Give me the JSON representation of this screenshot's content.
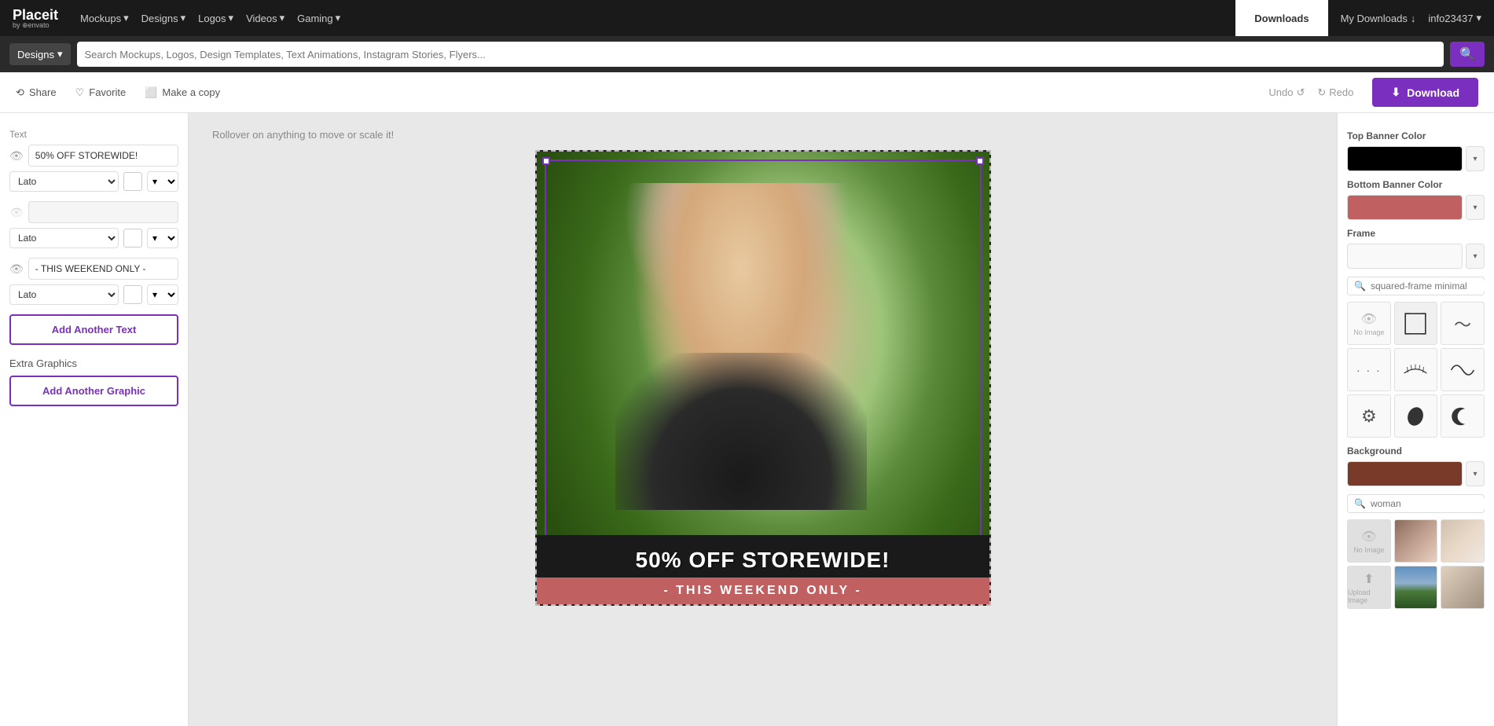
{
  "topnav": {
    "logo": "Placeit",
    "logo_sub": "by ⊕envato",
    "nav_items": [
      {
        "label": "Mockups",
        "id": "mockups"
      },
      {
        "label": "Designs",
        "id": "designs"
      },
      {
        "label": "Logos",
        "id": "logos"
      },
      {
        "label": "Videos",
        "id": "videos"
      },
      {
        "label": "Gaming",
        "id": "gaming"
      }
    ],
    "downloads_label": "Downloads",
    "my_downloads_label": "My Downloads",
    "account_label": "info23437"
  },
  "searchbar": {
    "dropdown_label": "Designs",
    "placeholder": "Search Mockups, Logos, Design Templates, Text Animations, Instagram Stories, Flyers..."
  },
  "toolbar": {
    "share_label": "Share",
    "favorite_label": "Favorite",
    "make_copy_label": "Make a copy",
    "undo_label": "Undo",
    "redo_label": "Redo",
    "download_label": "Download"
  },
  "left_panel": {
    "text_label": "Text",
    "text_fields": [
      {
        "value": "50% OFF STOREWIDE!",
        "visible": true
      },
      {
        "value": "",
        "visible": false
      },
      {
        "value": "- THIS WEEKEND ONLY -",
        "visible": true
      }
    ],
    "font": "Lato",
    "add_text_label": "Add Another Text",
    "extra_graphics_label": "Extra Graphics",
    "add_graphic_label": "Add Another Graphic"
  },
  "canvas": {
    "hint": "Rollover on anything to move or scale it!",
    "main_text": "50% OFF STOREWIDE!",
    "sub_text": "- THIS WEEKEND ONLY -"
  },
  "right_panel": {
    "top_banner_color_label": "Top Banner Color",
    "top_banner_color": "#000000",
    "bottom_banner_color_label": "Bottom Banner Color",
    "bottom_banner_color": "#c06060",
    "frame_label": "Frame",
    "frame_search_placeholder": "squared-frame minimal",
    "background_label": "Background",
    "background_color": "#7a3a2a",
    "bg_search_placeholder": "woman",
    "frame_items": [
      {
        "type": "no-image",
        "label": "No Image"
      },
      {
        "type": "square-frame"
      },
      {
        "type": "swirl"
      },
      {
        "type": "dots"
      },
      {
        "type": "eyelash"
      },
      {
        "type": "wave"
      },
      {
        "type": "gear"
      },
      {
        "type": "blob"
      },
      {
        "type": "crescent"
      }
    ],
    "bg_items": [
      {
        "type": "no-image",
        "label": "No Image"
      },
      {
        "type": "photo-woman1"
      },
      {
        "type": "photo-woman2"
      },
      {
        "type": "photo-landscape"
      },
      {
        "type": "upload",
        "label": "Upload Image"
      },
      {
        "type": "photo-woman3"
      },
      {
        "type": "photo-woman4"
      }
    ]
  }
}
